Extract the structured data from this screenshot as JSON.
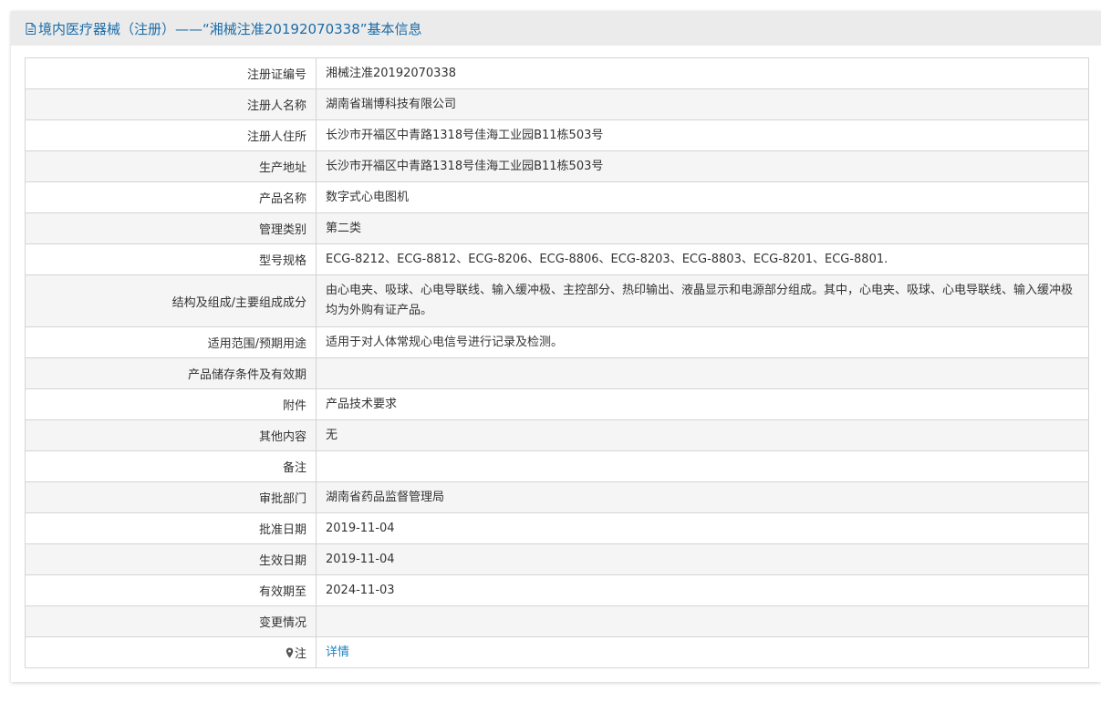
{
  "header": {
    "title": "境内医疗器械（注册）——“湘械注准20192070338”基本信息"
  },
  "rows": [
    {
      "label": "注册证编号",
      "value": "湘械注准20192070338"
    },
    {
      "label": "注册人名称",
      "value": "湖南省瑞博科技有限公司"
    },
    {
      "label": "注册人住所",
      "value": "长沙市开福区中青路1318号佳海工业园B11栋503号"
    },
    {
      "label": "生产地址",
      "value": "长沙市开福区中青路1318号佳海工业园B11栋503号"
    },
    {
      "label": "产品名称",
      "value": "数字式心电图机"
    },
    {
      "label": "管理类别",
      "value": "第二类"
    },
    {
      "label": "型号规格",
      "value": "ECG-8212、ECG-8812、ECG-8206、ECG-8806、ECG-8203、ECG-8803、ECG-8201、ECG-8801."
    },
    {
      "label": "结构及组成/主要组成成分",
      "value": "由心电夹、吸球、心电导联线、输入缓冲极、主控部分、热印输出、液晶显示和电源部分组成。其中，心电夹、吸球、心电导联线、输入缓冲极均为外购有证产品。"
    },
    {
      "label": "适用范围/预期用途",
      "value": "适用于对人体常规心电信号进行记录及检测。"
    },
    {
      "label": "产品储存条件及有效期",
      "value": ""
    },
    {
      "label": "附件",
      "value": "产品技术要求"
    },
    {
      "label": "其他内容",
      "value": "无"
    },
    {
      "label": "备注",
      "value": ""
    },
    {
      "label": "审批部门",
      "value": "湖南省药品监督管理局"
    },
    {
      "label": "批准日期",
      "value": "2019-11-04"
    },
    {
      "label": "生效日期",
      "value": "2019-11-04"
    },
    {
      "label": "有效期至",
      "value": "2024-11-03"
    },
    {
      "label": "变更情况",
      "value": ""
    }
  ],
  "note": {
    "label": "注",
    "icon": "pin-icon",
    "link_text": "详情"
  },
  "colors": {
    "header_text": "#1b6ca8",
    "link": "#1b84c4",
    "border": "#d4d4d4",
    "stripe": "#f5f5f5"
  }
}
